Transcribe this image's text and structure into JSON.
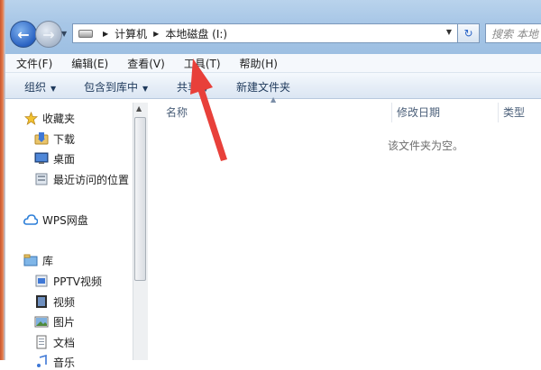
{
  "address_bar": {
    "breadcrumbs": [
      "计算机",
      "本地磁盘 (I:)"
    ],
    "search_placeholder": "搜索 本地"
  },
  "menu": [
    "文件(F)",
    "编辑(E)",
    "查看(V)",
    "工具(T)",
    "帮助(H)"
  ],
  "toolbar": {
    "organize": "组织",
    "include_in_library": "包含到库中",
    "share": "共享",
    "new_folder": "新建文件夹"
  },
  "sidebar": {
    "favorites": {
      "label": "收藏夹",
      "items": [
        "下载",
        "桌面",
        "最近访问的位置"
      ]
    },
    "wps": {
      "label": "WPS网盘"
    },
    "libraries": {
      "label": "库",
      "items": [
        "PPTV视频",
        "视频",
        "图片",
        "文档",
        "音乐"
      ]
    }
  },
  "columns": [
    "名称",
    "修改日期",
    "类型"
  ],
  "empty_message": "该文件夹为空。",
  "icons": {
    "back": "back-arrow-icon",
    "forward": "forward-arrow-icon",
    "drive": "drive-icon",
    "refresh": "refresh-icon",
    "favorites": "star-icon",
    "downloads": "downloads-folder-icon",
    "desktop": "desktop-icon",
    "recent": "recent-places-icon",
    "wps": "cloud-icon",
    "library": "library-icon",
    "pptv": "pptv-video-icon",
    "video": "video-icon",
    "pictures": "picture-icon",
    "documents": "document-icon"
  },
  "colors": {
    "annotation_arrow": "#e8403a",
    "chrome_blue": "#a7c6e6",
    "nav_back_blue": "#2a62c2"
  }
}
